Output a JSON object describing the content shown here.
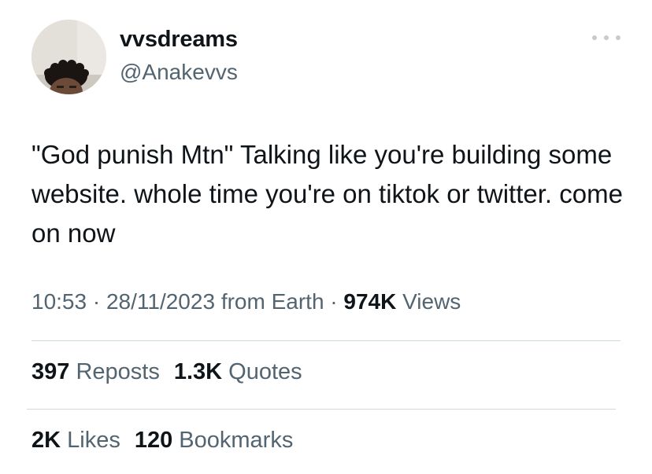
{
  "user": {
    "display_name": "vvsdreams",
    "handle": "@Anakevvs"
  },
  "tweet": {
    "text": "\"God punish Mtn\" Talking like you're building some website. whole time you're on tiktok or twitter. come on now",
    "time": "10:53",
    "date": "28/11/2023",
    "source": "from Earth",
    "separator": "·",
    "views_count": "974K",
    "views_label": "Views"
  },
  "stats": {
    "reposts_count": "397",
    "reposts_label": "Reposts",
    "quotes_count": "1.3K",
    "quotes_label": "Quotes",
    "likes_count": "2K",
    "likes_label": "Likes",
    "bookmarks_count": "120",
    "bookmarks_label": "Bookmarks"
  },
  "icons": {
    "more": "more-dots-icon"
  },
  "colors": {
    "text_primary": "#0f1419",
    "text_secondary": "#536471",
    "divider": "#cfd9de"
  }
}
